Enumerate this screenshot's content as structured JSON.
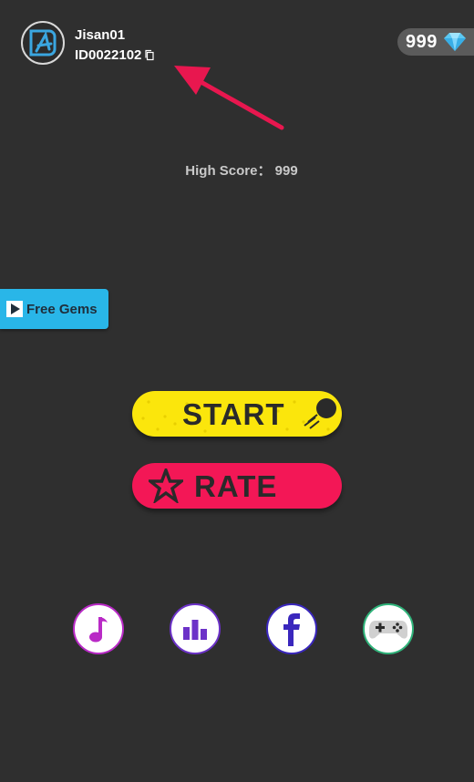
{
  "profile": {
    "username": "Jisan01",
    "user_id": "ID0022102",
    "avatar_icon": "logo-icon",
    "copy_icon": "copy-icon"
  },
  "gems": {
    "count": "999",
    "icon": "diamond-icon"
  },
  "high_score": {
    "text": "High Score： 999"
  },
  "free_gems": {
    "label": "Free Gems",
    "icon": "play-icon",
    "color": "#29b6e8"
  },
  "start": {
    "label": "START",
    "icon": "ball-icon",
    "color": "#fbe60c"
  },
  "rate": {
    "label": "RATE",
    "icon": "star-icon",
    "color": "#f31756"
  },
  "bottom_buttons": [
    {
      "icon": "music-note-icon",
      "color": "#b92ac6"
    },
    {
      "icon": "leaderboard-icon",
      "color": "#6c32c8"
    },
    {
      "icon": "facebook-icon",
      "color": "#3a27bd"
    },
    {
      "icon": "gamepad-icon",
      "color": "#2fb37a"
    }
  ],
  "annotation": {
    "icon": "pointer-arrow-icon",
    "color": "#e8174f"
  },
  "colors": {
    "background": "#2f2f2f",
    "gem_pill": "#5b5b5b"
  }
}
